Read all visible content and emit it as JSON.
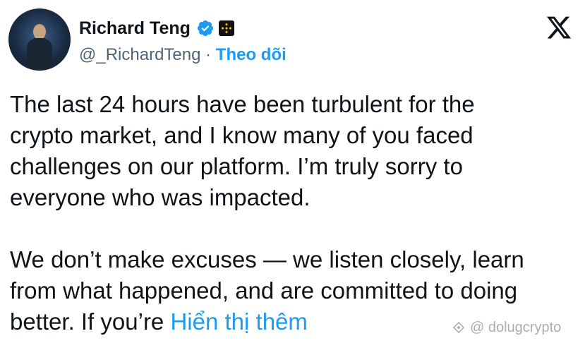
{
  "author": {
    "name": "Richard Teng",
    "handle": "@_RichardTeng",
    "separator": "·",
    "follow_label": "Theo dõi"
  },
  "icons": {
    "avatar": "profile-photo",
    "verified": "verified-badge-icon",
    "org": "binance-logo-icon",
    "brand": "x-logo-icon"
  },
  "tweet": {
    "line1": "The last 24 hours have been turbulent for the",
    "line2": "crypto market, and I know many of you faced",
    "line3": "challenges on our platform. I’m truly sorry to",
    "line4": "everyone who was impacted.",
    "line5": "We don’t make excuses — we listen closely, learn",
    "line6": "from what happened, and are committed to doing",
    "line7": "better. If you’re",
    "show_more": "Hiển thị thêm"
  },
  "watermark": "@ dolugcrypto",
  "colors": {
    "accent": "#1d9bf0",
    "text": "#0f1419",
    "muted": "#536471",
    "binance_yellow": "#f0b90b"
  }
}
